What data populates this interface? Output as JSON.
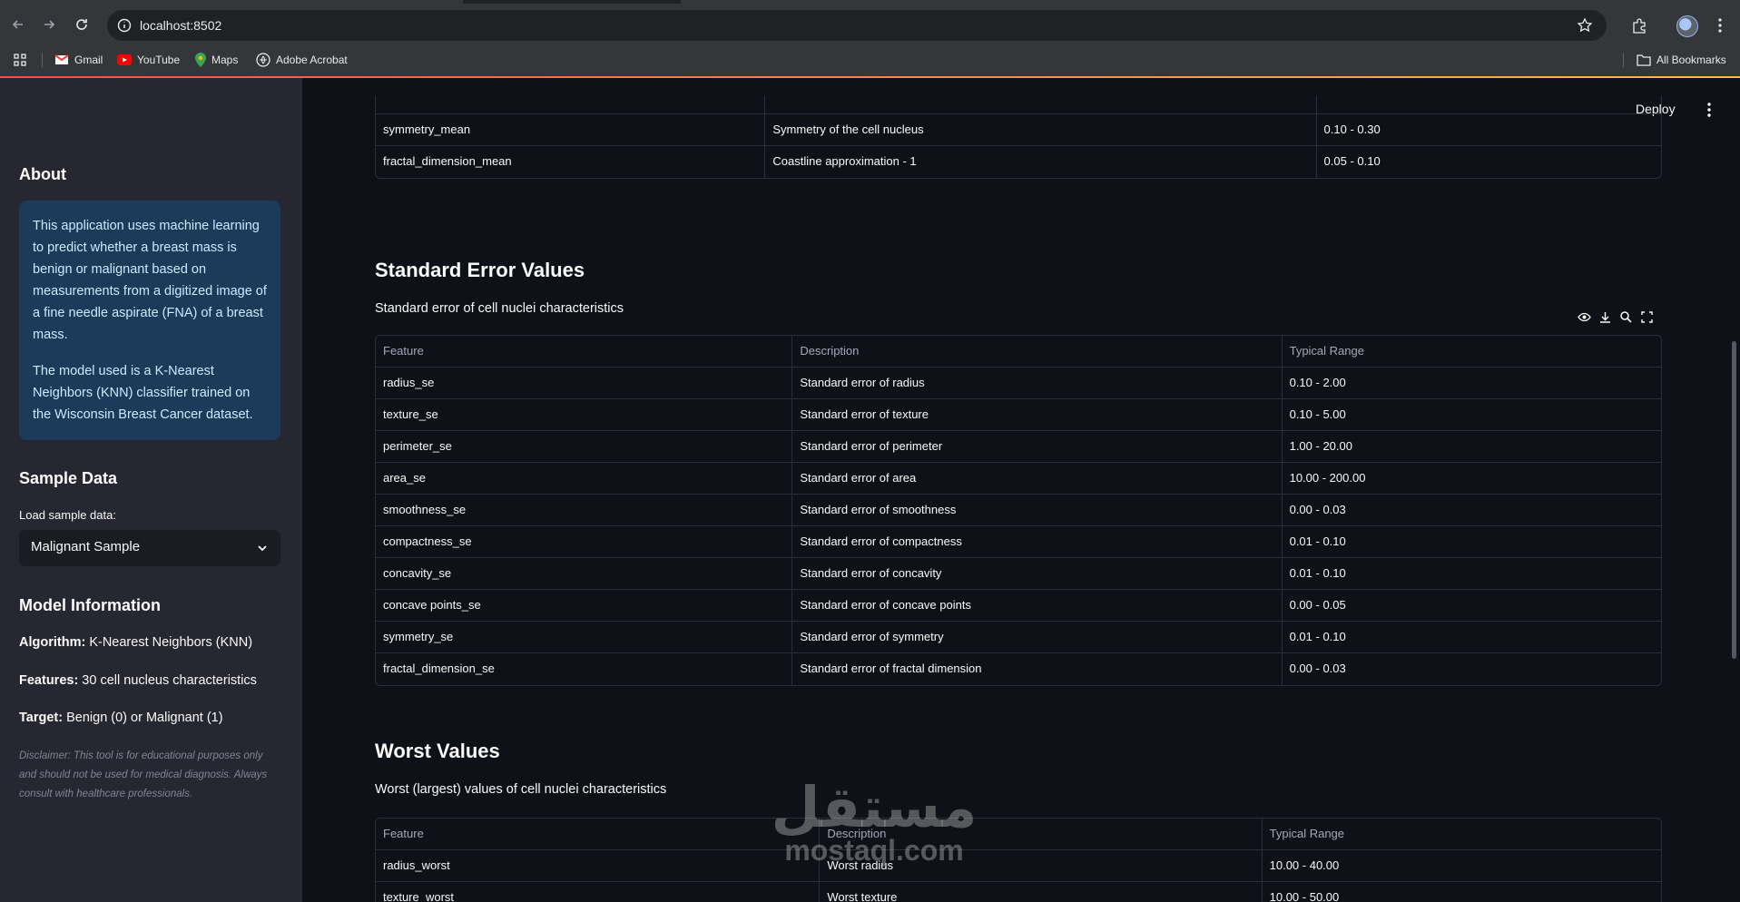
{
  "browser": {
    "url": "localhost:8502",
    "bookmarks": [
      {
        "label": "Gmail",
        "icon": "gmail-icon"
      },
      {
        "label": "YouTube",
        "icon": "youtube-icon"
      },
      {
        "label": "Maps",
        "icon": "maps-icon"
      },
      {
        "label": "Adobe Acrobat",
        "icon": "acrobat-icon"
      }
    ],
    "all_bookmarks": "All Bookmarks"
  },
  "app": {
    "deploy_label": "Deploy"
  },
  "sidebar": {
    "about_title": "About",
    "about_p1": "This application uses machine learning to predict whether a breast mass is benign or malignant based on measurements from a digitized image of a fine needle aspirate (FNA) of a breast mass.",
    "about_p2": "The model used is a K-Nearest Neighbors (KNN) classifier trained on the Wisconsin Breast Cancer dataset.",
    "sample_title": "Sample Data",
    "sample_label": "Load sample data:",
    "sample_value": "Malignant Sample",
    "model_title": "Model Information",
    "algorithm_key": "Algorithm:",
    "algorithm_val": " K-Nearest Neighbors (KNN)",
    "features_key": "Features:",
    "features_val": " 30 cell nucleus characteristics",
    "target_key": "Target:",
    "target_val": " Benign (0) or Malignant (1)",
    "disclaimer": "Disclaimer: This tool is for educational purposes only and should not be used for medical diagnosis. Always consult with healthcare professionals."
  },
  "mean_table": {
    "rows": [
      [
        "symmetry_mean",
        "Symmetry of the cell nucleus",
        "0.10 - 0.30"
      ],
      [
        "fractal_dimension_mean",
        "Coastline approximation - 1",
        "0.05 - 0.10"
      ]
    ]
  },
  "se_section": {
    "title": "Standard Error Values",
    "subtitle": "Standard error of cell nuclei characteristics",
    "headers": [
      "Feature",
      "Description",
      "Typical Range"
    ],
    "rows": [
      [
        "radius_se",
        "Standard error of radius",
        "0.10 - 2.00"
      ],
      [
        "texture_se",
        "Standard error of texture",
        "0.10 - 5.00"
      ],
      [
        "perimeter_se",
        "Standard error of perimeter",
        "1.00 - 20.00"
      ],
      [
        "area_se",
        "Standard error of area",
        "10.00 - 200.00"
      ],
      [
        "smoothness_se",
        "Standard error of smoothness",
        "0.00 - 0.03"
      ],
      [
        "compactness_se",
        "Standard error of compactness",
        "0.01 - 0.10"
      ],
      [
        "concavity_se",
        "Standard error of concavity",
        "0.01 - 0.10"
      ],
      [
        "concave points_se",
        "Standard error of concave points",
        "0.00 - 0.05"
      ],
      [
        "symmetry_se",
        "Standard error of symmetry",
        "0.01 - 0.10"
      ],
      [
        "fractal_dimension_se",
        "Standard error of fractal dimension",
        "0.00 - 0.03"
      ]
    ]
  },
  "worst_section": {
    "title": "Worst Values",
    "subtitle": "Worst (largest) values of cell nuclei characteristics",
    "headers": [
      "Feature",
      "Description",
      "Typical Range"
    ],
    "rows": [
      [
        "radius_worst",
        "Worst radius",
        "10.00 - 40.00"
      ],
      [
        "texture_worst",
        "Worst texture",
        "10.00 - 50.00"
      ]
    ]
  },
  "watermark": {
    "arabic": "مستقل",
    "latin": "mostaql.com"
  },
  "colors": {
    "sidebar_bg": "#262730",
    "main_bg": "#0e1117",
    "info_bg": "#1c3a5a",
    "info_text": "#c7ebff",
    "accent": "#ff4b4b"
  }
}
